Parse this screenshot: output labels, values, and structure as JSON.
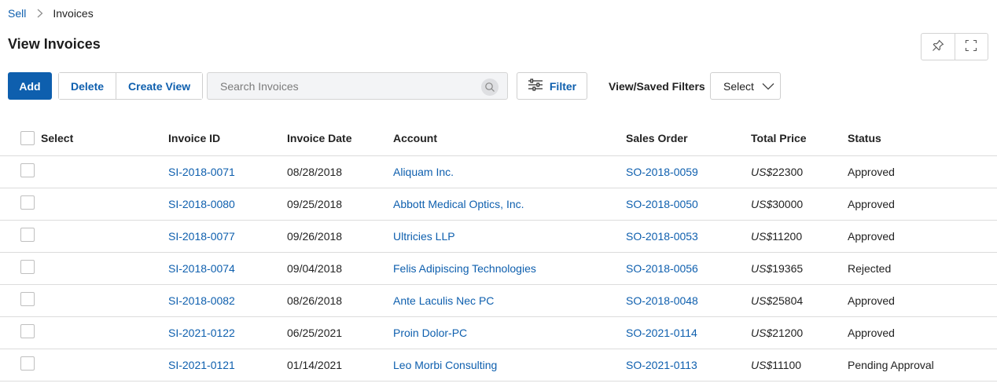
{
  "breadcrumb": {
    "parent": "Sell",
    "current": "Invoices"
  },
  "page": {
    "title": "View Invoices"
  },
  "toolbar": {
    "add_label": "Add",
    "delete_label": "Delete",
    "create_view_label": "Create View",
    "search_placeholder": "Search Invoices",
    "filter_label": "Filter",
    "saved_filters_label": "View/Saved Filters",
    "select_value": "Select"
  },
  "table": {
    "headers": {
      "select": "Select",
      "invoice_id": "Invoice ID",
      "invoice_date": "Invoice Date",
      "account": "Account",
      "sales_order": "Sales Order",
      "total_price": "Total Price",
      "status": "Status"
    },
    "currency": "US$",
    "rows": [
      {
        "invoice_id": "SI-2018-0071",
        "date": "08/28/2018",
        "account": "Aliquam Inc.",
        "sales_order": "SO-2018-0059",
        "price": "22300",
        "status": "Approved"
      },
      {
        "invoice_id": "SI-2018-0080",
        "date": "09/25/2018",
        "account": "Abbott Medical Optics, Inc.",
        "sales_order": "SO-2018-0050",
        "price": "30000",
        "status": "Approved"
      },
      {
        "invoice_id": "SI-2018-0077",
        "date": "09/26/2018",
        "account": "Ultricies LLP",
        "sales_order": "SO-2018-0053",
        "price": "11200",
        "status": "Approved"
      },
      {
        "invoice_id": "SI-2018-0074",
        "date": "09/04/2018",
        "account": "Felis Adipiscing Technologies",
        "sales_order": "SO-2018-0056",
        "price": "19365",
        "status": "Rejected"
      },
      {
        "invoice_id": "SI-2018-0082",
        "date": "08/26/2018",
        "account": "Ante Laculis Nec PC",
        "sales_order": "SO-2018-0048",
        "price": "25804",
        "status": "Approved"
      },
      {
        "invoice_id": "SI-2021-0122",
        "date": "06/25/2021",
        "account": "Proin Dolor-PC",
        "sales_order": "SO-2021-0114",
        "price": "21200",
        "status": "Approved"
      },
      {
        "invoice_id": "SI-2021-0121",
        "date": "01/14/2021",
        "account": "Leo Morbi Consulting",
        "sales_order": "SO-2021-0113",
        "price": "11100",
        "status": "Pending Approval"
      }
    ]
  },
  "colors": {
    "accent": "#0e5fae",
    "border": "#dcdcdc",
    "search_bg": "#f3f4f6"
  },
  "icons": {
    "pin": "pin-icon",
    "expand": "expand-icon",
    "search": "search-icon",
    "filter": "filter-icon",
    "chevron": "chevron-down-icon",
    "separator": "chevron-right-icon"
  }
}
